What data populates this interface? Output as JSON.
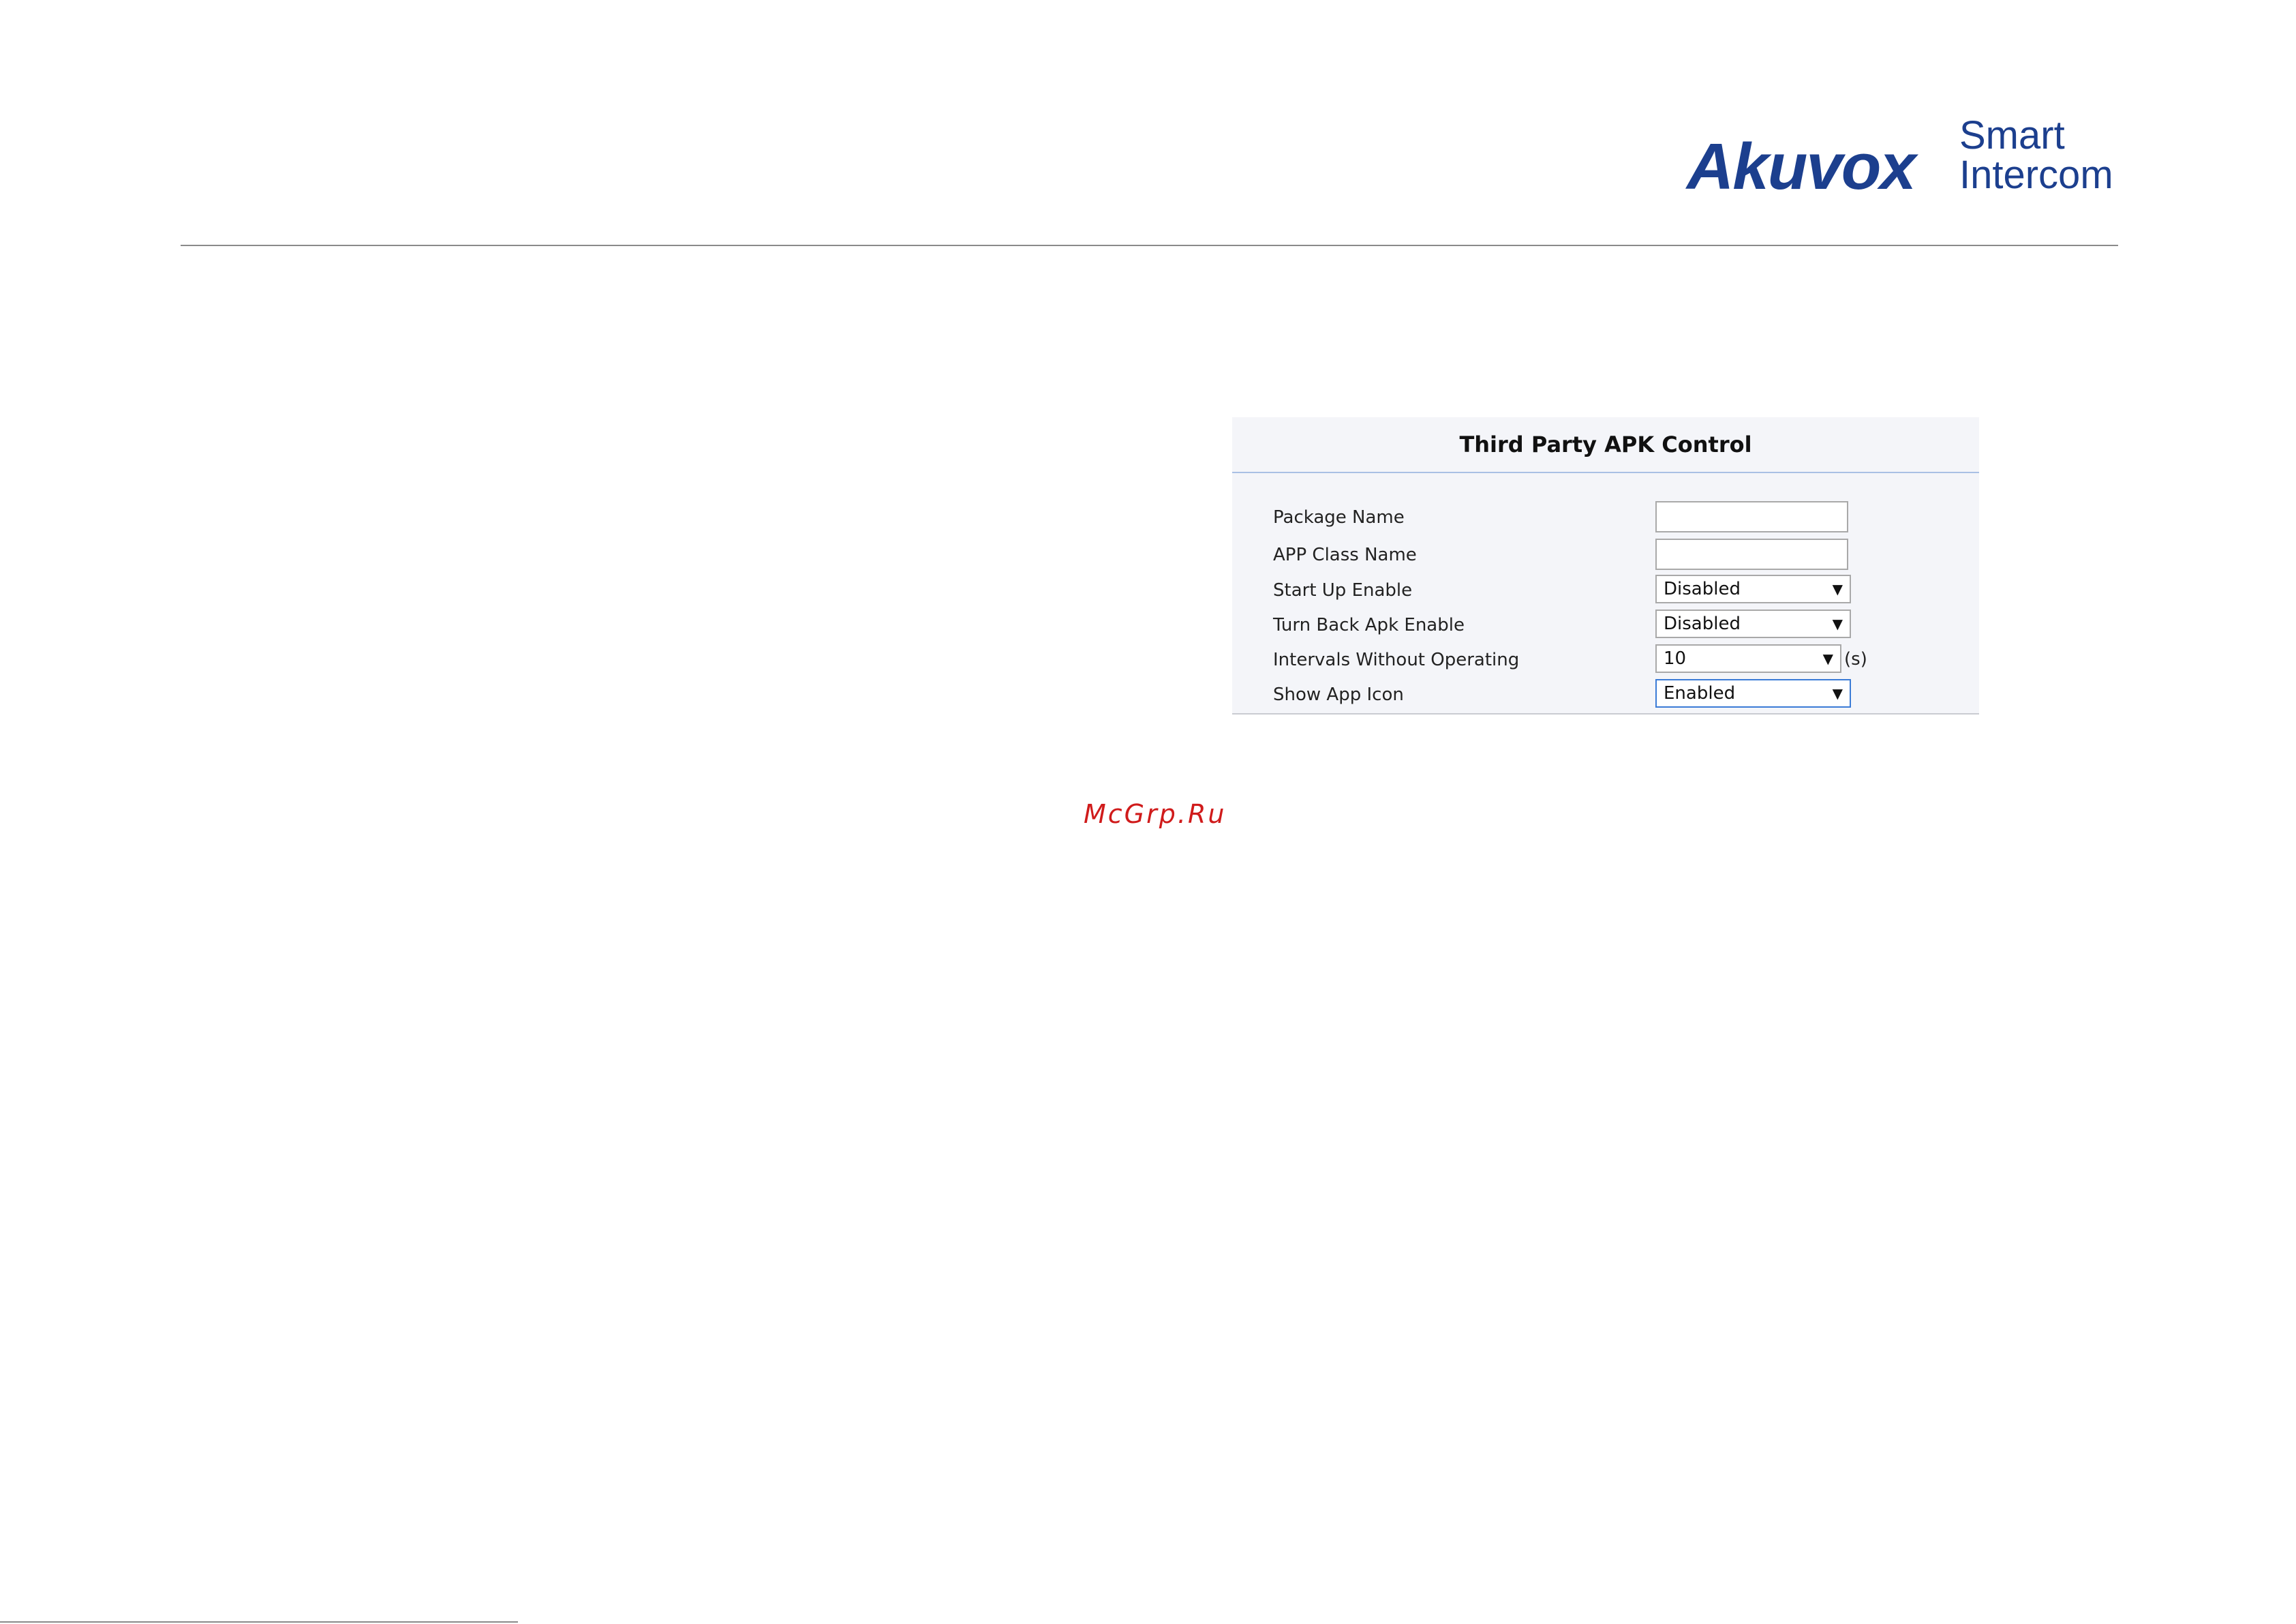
{
  "header": {
    "logo_brand": "Akuvox",
    "logo_tag_line1": "Smart",
    "logo_tag_line2": "Intercom"
  },
  "panel": {
    "title": "Third Party APK Control",
    "fields": {
      "package_name": {
        "label": "Package Name",
        "value": ""
      },
      "app_class_name": {
        "label": "APP Class Name",
        "value": ""
      },
      "start_up_enable": {
        "label": "Start Up Enable",
        "value": "Disabled"
      },
      "turn_back_apk_enable": {
        "label": "Turn Back Apk Enable",
        "value": "Disabled"
      },
      "intervals_without_operating": {
        "label": "Intervals Without Operating",
        "value": "10",
        "unit": "(s)"
      },
      "show_app_icon": {
        "label": "Show App Icon",
        "value": "Enabled"
      }
    }
  },
  "watermark": "McGrp.Ru",
  "icons": {
    "dropdown": "chevron-down-icon"
  },
  "colors": {
    "brand": "#1c3f8e",
    "panel_background": "#f4f5f9",
    "title_underline": "#a9c0e4",
    "focus_border": "#3b7bd6",
    "watermark": "#d01b1b"
  }
}
